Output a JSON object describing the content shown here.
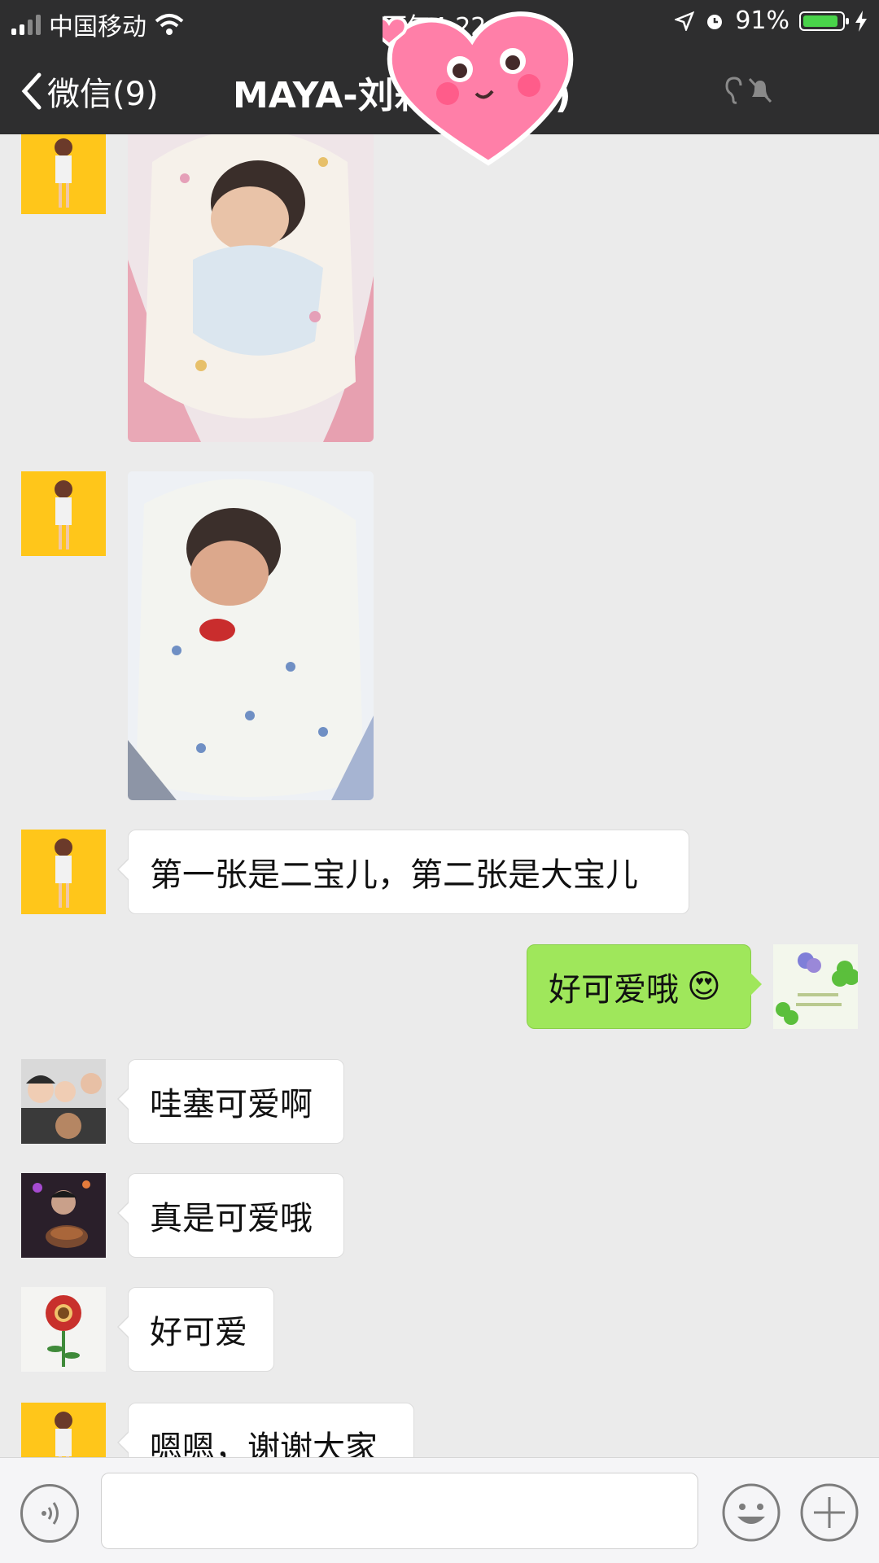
{
  "status_bar": {
    "carrier": "中国移动",
    "time": "下午4:22",
    "battery": "91%",
    "battery_level": 0.91
  },
  "nav": {
    "back_label": "微信(9)",
    "title": "MAYA-刘莉    易群(1)"
  },
  "messages": [
    {
      "type": "image",
      "side": "left",
      "avatar": "girl-yellow-avatar",
      "description": "newborn-in-pink-blanket"
    },
    {
      "type": "image",
      "side": "left",
      "avatar": "girl-yellow-avatar",
      "description": "newborn-in-blue-flower-blanket"
    },
    {
      "type": "text",
      "side": "left",
      "avatar": "girl-yellow-avatar",
      "text": "第一张是二宝儿，第二张是大宝儿"
    },
    {
      "type": "text",
      "side": "right",
      "avatar": "clover-avatar",
      "text": "好可爱哦",
      "emoji": "😍"
    },
    {
      "type": "text",
      "side": "left",
      "avatar": "family-avatar",
      "text": "哇塞可爱啊"
    },
    {
      "type": "text",
      "side": "left",
      "avatar": "dark-photo-avatar",
      "text": "真是可爱哦"
    },
    {
      "type": "text",
      "side": "left",
      "avatar": "flower-avatar",
      "text": "好可爱"
    },
    {
      "type": "text",
      "side": "left",
      "avatar": "girl-yellow-avatar",
      "text": "嗯嗯，谢谢大家"
    }
  ],
  "input": {
    "value": "",
    "placeholder": ""
  },
  "colors": {
    "header": "#2e2e2f",
    "chat_bg": "#ebebeb",
    "my_bubble": "#9fe75b",
    "other_bubble": "#ffffff"
  }
}
